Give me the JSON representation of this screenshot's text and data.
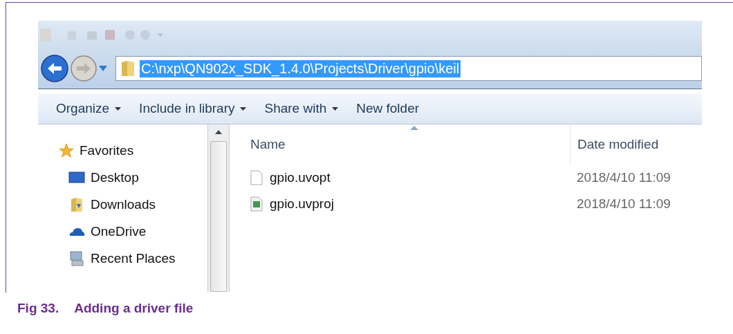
{
  "explorer": {
    "forward": {
      "disabled": true
    },
    "address": {
      "path": "C:\\nxp\\QN902x_SDK_1.4.0\\Projects\\Driver\\gpio\\keil",
      "selected": true
    },
    "commands": [
      {
        "label": "Organize",
        "has_menu": true
      },
      {
        "label": "Include in library",
        "has_menu": true
      },
      {
        "label": "Share with",
        "has_menu": true
      },
      {
        "label": "New folder",
        "has_menu": false
      }
    ],
    "navigation": {
      "label": "Favorites",
      "children": [
        {
          "label": "Desktop",
          "kind": "desktop"
        },
        {
          "label": "Downloads",
          "kind": "downloads"
        },
        {
          "label": "OneDrive",
          "kind": "cloud"
        },
        {
          "label": "Recent Places",
          "kind": "recent"
        }
      ]
    },
    "columns": [
      {
        "label": "Name",
        "sorted": true
      },
      {
        "label": "Date modified",
        "sorted": false
      }
    ],
    "files": [
      {
        "name": "gpio.uvopt",
        "date": "2018/4/10 11:09",
        "kind": "document"
      },
      {
        "name": "gpio.uvproj",
        "date": "2018/4/10 11:09",
        "kind": "project"
      }
    ]
  },
  "caption": {
    "number": "Fig 33.",
    "title": "Adding a driver file"
  }
}
